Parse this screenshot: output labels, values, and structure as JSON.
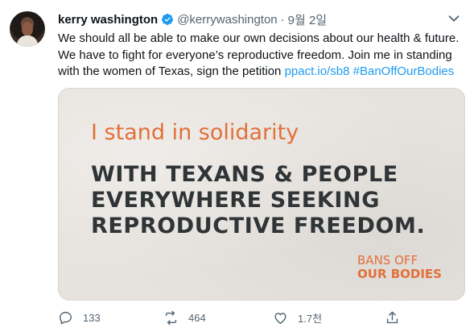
{
  "author": {
    "name": "kerry washington",
    "handle": "@kerrywashington",
    "separator": "·",
    "date": "9월 2일"
  },
  "tweet": {
    "text_line1": "We should all be able to make our own decisions about our health & future.",
    "text_line2": "We have to fight for everyone’s reproductive freedom. Join me in standing",
    "text_line3_prefix": "with the women of Texas, sign the petition ",
    "link": "ppact.io/sb8",
    "hashtag": "#BanOffOurBodies"
  },
  "media": {
    "solidarity": "I stand in solidarity",
    "headline": "WITH TEXANS & PEOPLE\nEVERYWHERE SEEKING\nREPRODUCTIVE FREEDOM.",
    "logo_line1": "BANS OFF",
    "logo_line2": "OUR BODIES"
  },
  "actions": {
    "reply_count": "133",
    "retweet_count": "464",
    "like_count": "1.7천"
  },
  "colors": {
    "link": "#1d9bf0",
    "verified": "#1d9bf0",
    "orange": "#e2703a",
    "secondary": "#536471"
  }
}
